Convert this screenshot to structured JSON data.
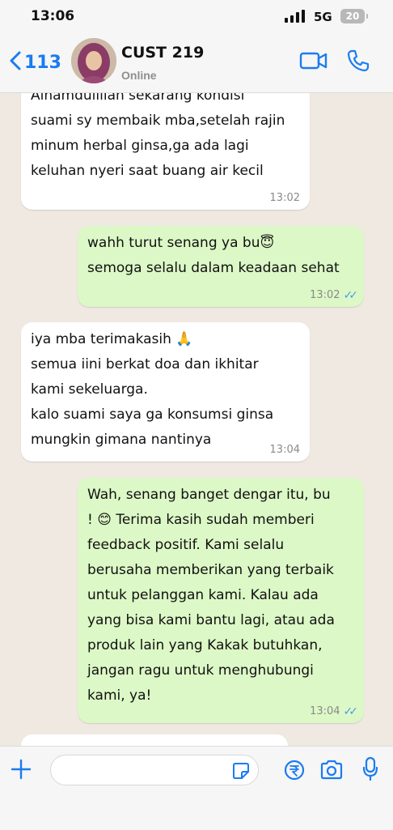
{
  "status_bar": {
    "time": "13:06",
    "network": "5G",
    "battery": "20"
  },
  "header": {
    "back_count": "113",
    "contact_name": "CUST 219",
    "contact_status": "Online",
    "accent_color": "#1a7cf0"
  },
  "messages": [
    {
      "direction": "incoming",
      "lines": [
        "Alhamdulillah sekarang kondisi",
        "suami sy membaik mba,setelah rajin",
        "minum herbal ginsa,ga ada lagi",
        "keluhan nyeri saat buang air kecil"
      ],
      "time": "13:02"
    },
    {
      "direction": "outgoing",
      "lines": [
        "wahh turut senang ya bu😇",
        "semoga selalu dalam keadaan sehat"
      ],
      "time": "13:02",
      "read": true
    },
    {
      "direction": "incoming",
      "lines": [
        "iya mba terimakasih 🙏",
        "semua iini berkat doa dan ikhitar",
        "kami sekeluarga.",
        "kalo suami saya ga konsumsi ginsa",
        "mungkin gimana nantinya"
      ],
      "time": "13:04"
    },
    {
      "direction": "outgoing",
      "lines": [
        "Wah, senang banget dengar itu, bu",
        "! 😊 Terima kasih sudah memberi",
        "feedback positif. Kami selalu",
        "berusaha memberikan yang terbaik",
        "untuk pelanggan kami. Kalau ada",
        "yang bisa kami bantu lagi, atau ada",
        "produk lain yang Kakak butuhkan,",
        "jangan ragu untuk menghubungi",
        "kami, ya!"
      ],
      "time": "13:04",
      "read": true
    }
  ],
  "colors": {
    "incoming_bubble": "#ffffff",
    "outgoing_bubble": "#dcf8c6",
    "chat_background": "#efe9e2",
    "read_ticks": "#4a9ee8"
  }
}
